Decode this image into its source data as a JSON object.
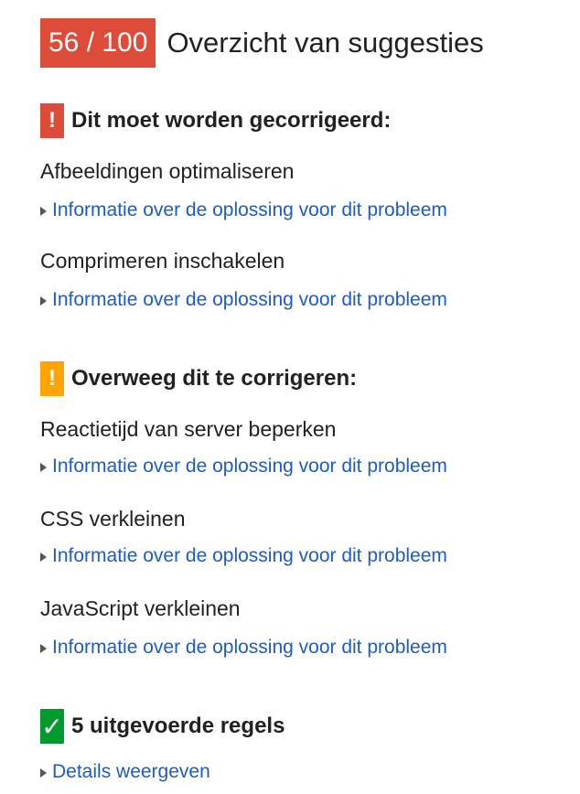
{
  "header": {
    "score": "56 / 100",
    "title": "Overzicht van suggesties"
  },
  "colors": {
    "score_bg": "#dd4b39",
    "must_fix": "#dd4b39",
    "consider_fix": "#ffa400",
    "passed": "#009a2d",
    "link": "#1a5cc8"
  },
  "sections": {
    "must_fix": {
      "badge_icon": "exclamation-icon",
      "badge_glyph": "!",
      "title": "Dit moet worden gecorrigeerd:",
      "rules": [
        {
          "name": "Afbeeldingen optimaliseren",
          "link": "Informatie over de oplossing voor dit probleem"
        },
        {
          "name": "Comprimeren inschakelen",
          "link": "Informatie over de oplossing voor dit probleem"
        }
      ]
    },
    "consider_fix": {
      "badge_icon": "exclamation-icon",
      "badge_glyph": "!",
      "title": "Overweeg dit te corrigeren:",
      "rules": [
        {
          "name": "Reactietijd van server beperken",
          "link": "Informatie over de oplossing voor dit probleem"
        },
        {
          "name": "CSS verkleinen",
          "link": "Informatie over de oplossing voor dit probleem"
        },
        {
          "name": "JavaScript verkleinen",
          "link": "Informatie over de oplossing voor dit probleem"
        }
      ]
    },
    "passed": {
      "badge_icon": "checkmark-icon",
      "badge_glyph": "✓",
      "title": "5 uitgevoerde regels",
      "link": "Details weergeven"
    }
  }
}
